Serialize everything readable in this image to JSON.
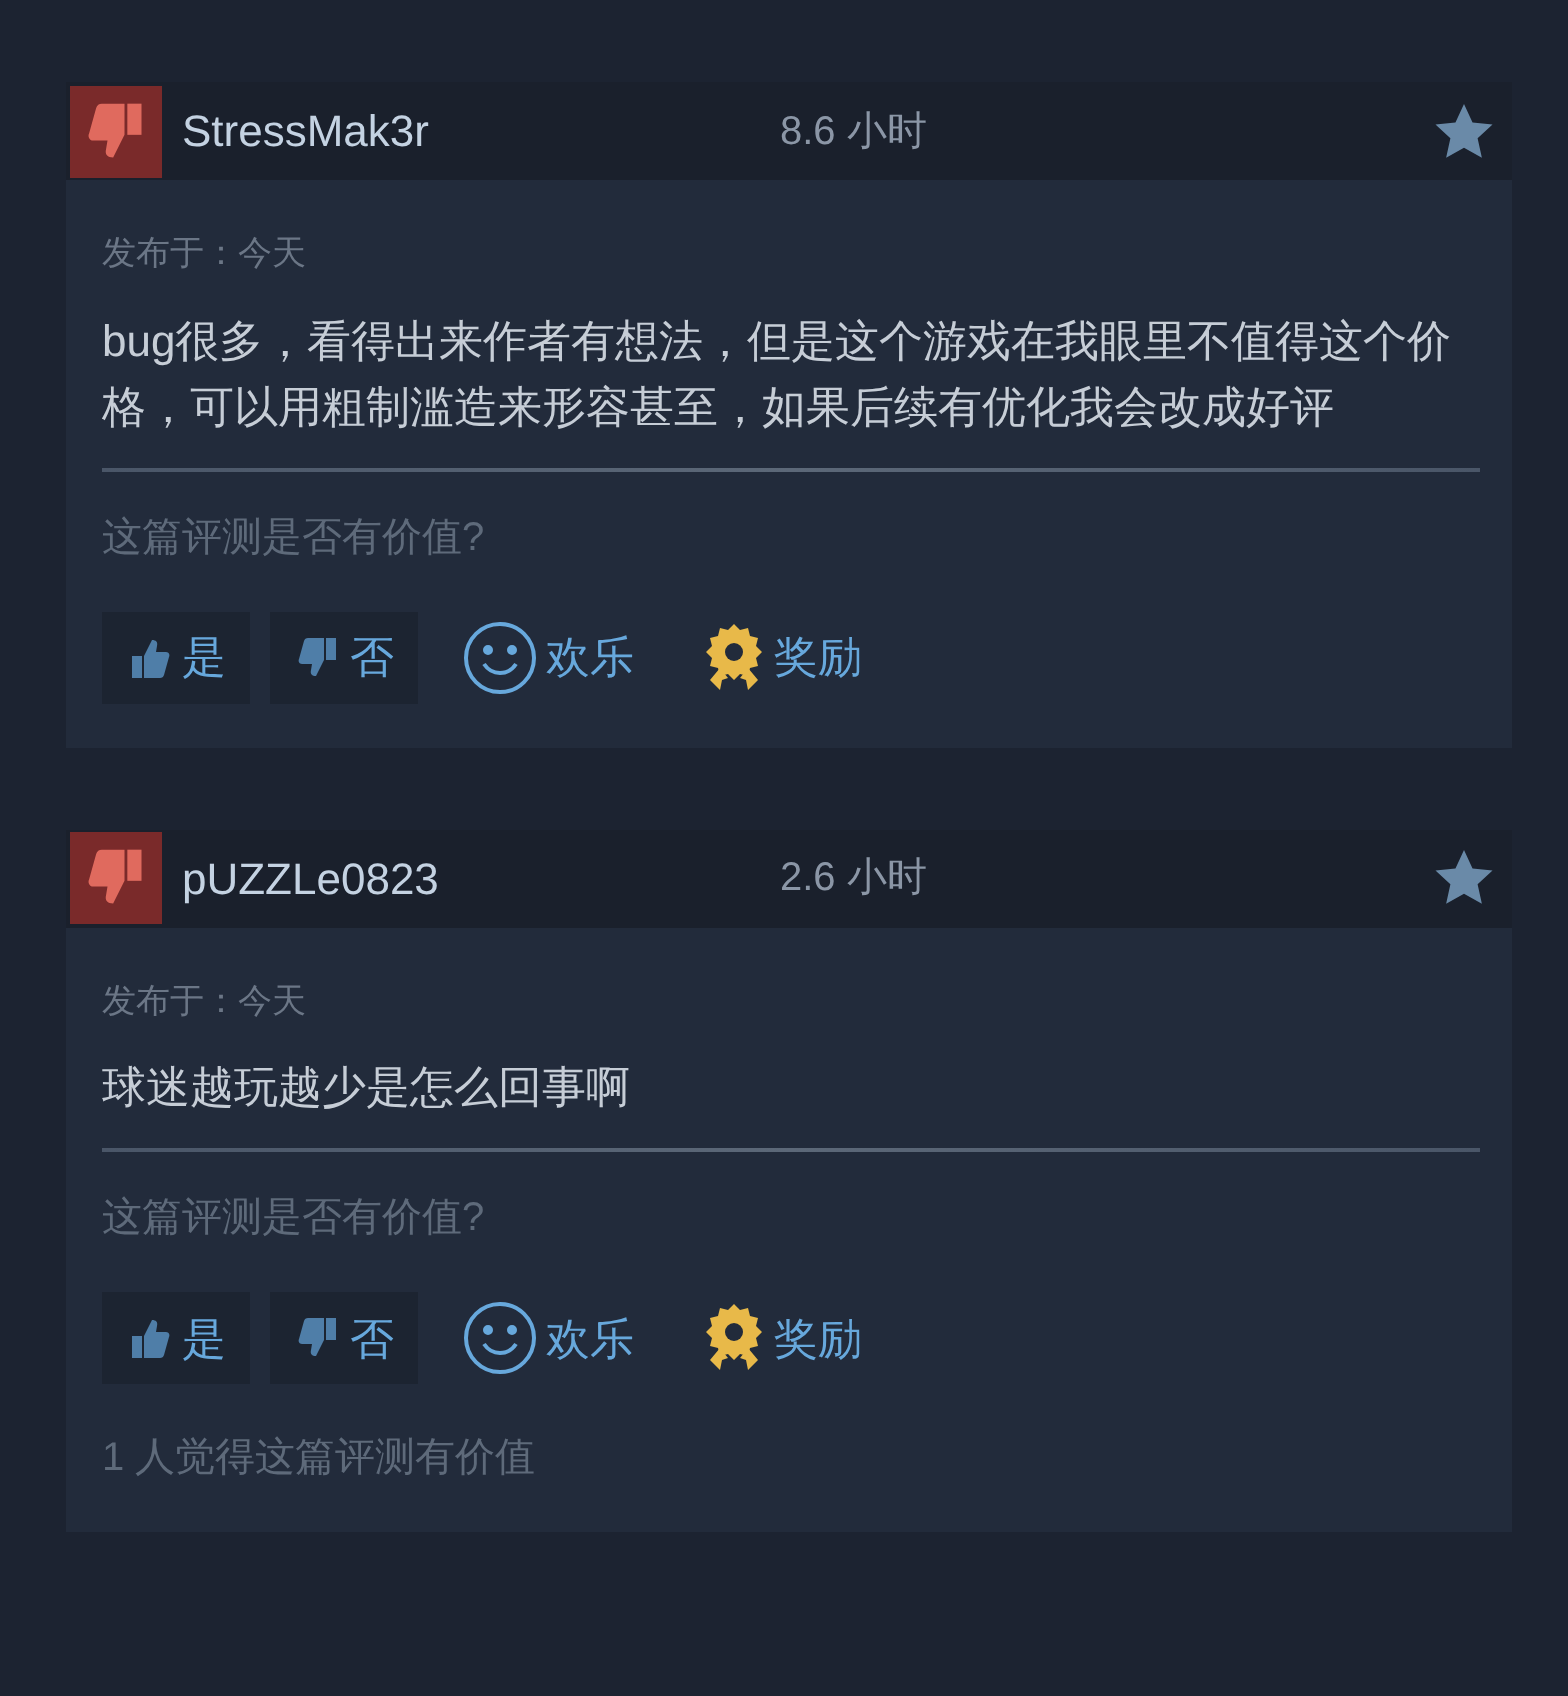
{
  "reviews": [
    {
      "author": "StressMak3r",
      "hours": "8.6 小时",
      "recommended": false,
      "posted": "发布于：今天",
      "text": "bug很多，看得出来作者有想法，但是这个游戏在我眼里不值得这个价格，可以用粗制滥造来形容甚至，如果后续有优化我会改成好评",
      "helpful_prompt": "这篇评测是否有价值?",
      "buttons": [
        {
          "kind": "yes",
          "label": "是"
        },
        {
          "kind": "no",
          "label": "否"
        },
        {
          "kind": "funny",
          "label": "欢乐"
        },
        {
          "kind": "award",
          "label": "奖励"
        }
      ]
    },
    {
      "author": "pUZZLe0823",
      "hours": "2.6 小时",
      "recommended": false,
      "posted": "发布于：今天",
      "text": "球迷越玩越少是怎么回事啊",
      "helpful_prompt": "这篇评测是否有价值?",
      "buttons": [
        {
          "kind": "yes",
          "label": "是"
        },
        {
          "kind": "no",
          "label": "否"
        },
        {
          "kind": "funny",
          "label": "欢乐"
        },
        {
          "kind": "award",
          "label": "奖励"
        }
      ],
      "helpful_count": "1 人觉得这篇评测有价值"
    }
  ]
}
